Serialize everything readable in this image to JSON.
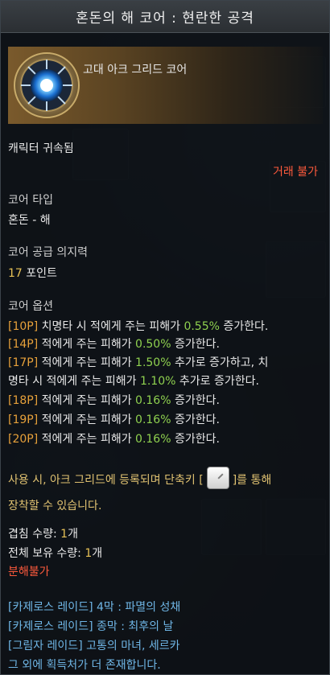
{
  "title": "혼돈의 해 코어 : 현란한 공격",
  "item": {
    "name": "고대 아크 그리드 코어",
    "bound": "캐릭터 귀속됨",
    "trade": "거래 불가"
  },
  "core_type": {
    "label": "코어 타입",
    "value": "혼돈 - 해"
  },
  "core_supply": {
    "label": "코어 공급 의지력",
    "value": "17",
    "unit": " 포인트"
  },
  "options": {
    "label": "코어 옵션",
    "lines": [
      {
        "tag": "[10P]",
        "t1": " 치명타 시 적에게 주는 피해가 ",
        "v1": "0.55%",
        "t2": " 증가한다."
      },
      {
        "tag": "[14P]",
        "t1": " 적에게 주는 피해가 ",
        "v1": "0.50%",
        "t2": " 증가한다."
      },
      {
        "tag": "[17P]",
        "t1": " 적에게 주는 피해가 ",
        "v1": "1.50%",
        "t2": " 추가로 증가하고, 치"
      },
      {
        "tag": "",
        "t1": "명타 시 적에게 주는 피해가 ",
        "v1": "1.10%",
        "t2": " 추가로 증가한다."
      },
      {
        "tag": "[18P]",
        "t1": " 적에게 주는 피해가 ",
        "v1": "0.16%",
        "t2": " 증가한다."
      },
      {
        "tag": "[19P]",
        "t1": " 적에게 주는 피해가 ",
        "v1": "0.16%",
        "t2": " 증가한다."
      },
      {
        "tag": "[20P]",
        "t1": " 적에게 주는 피해가 ",
        "v1": "0.16%",
        "t2": " 증가한다."
      }
    ]
  },
  "usage": {
    "line1_a": "사용 시, 아크 그리드에 등록되며 단축키 [",
    "line1_b": "]를 통해",
    "line2": "장착할 수 있습니다."
  },
  "stack": {
    "label": "겹침 수량: ",
    "value": "1",
    "unit": "개"
  },
  "total": {
    "label": "전체 보유 수량: ",
    "value": "1",
    "unit": "개"
  },
  "dismantle": "분해불가",
  "sources": [
    "[카제로스 레이드] 4막 : 파멸의 성채",
    "[카제로스 레이드] 종막 : 최후의 날",
    "[그림자 레이드] 고통의 마녀, 세르카",
    "그 외에 획득처가 더 존재합니다."
  ],
  "colors": {
    "tag": "#e6a03a",
    "value": "#8fd14f",
    "trade": "#ff5a3c",
    "source": "#6fb6e6",
    "count": "#e8c256"
  },
  "icons": {
    "item": "blue-sun-core-icon",
    "key": "key-slot-icon"
  }
}
